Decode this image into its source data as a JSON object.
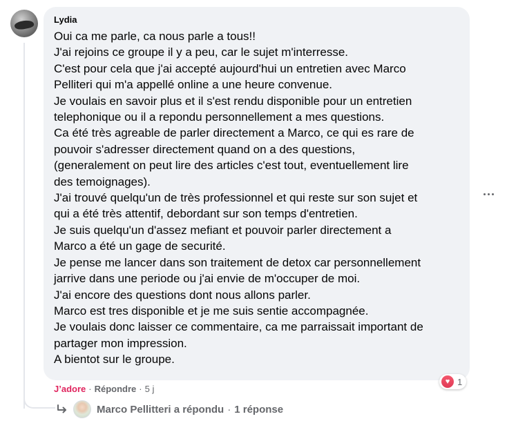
{
  "comment": {
    "author": "Lydia",
    "lines": [
      "Oui ca me parle, ca nous parle a tous!!",
      "J'ai rejoins ce groupe il y a peu, car le sujet m'interresse.",
      "C'est pour cela que j'ai accepté aujourd'hui un entretien avec Marco",
      "Pelliteri qui m'a appellé online a une heure convenue.",
      "Je voulais en savoir plus et il s'est rendu disponible pour un entretien",
      "telephonique ou il a repondu personnellement a mes questions.",
      "Ca été très agreable de parler directement a Marco, ce qui es rare de",
      "pouvoir s'adresser directement quand on a des questions,",
      "(generalement on peut lire des articles c'est tout, eventuellement lire",
      "des temoignages).",
      "J'ai trouvé quelqu'un de très professionnel et qui reste sur son sujet et",
      "qui a été très attentif, debordant sur son temps d'entretien.",
      "Je suis quelqu'un d'assez mefiant et pouvoir parler directement a",
      "Marco a été un gage de securité.",
      "Je pense me lancer dans son traitement de detox car personnellement",
      "jarrive dans une periode ou j'ai envie de m'occuper de moi.",
      "J'ai encore des questions dont nous allons parler.",
      "Marco est tres disponible et je me suis sentie accompagnée.",
      "Je voulais donc laisser ce commentaire, ca me parraissait important de",
      "partager mon impression.",
      "A bientot sur le groupe."
    ]
  },
  "actions": {
    "like_label": "J’adore",
    "separator": "·",
    "reply_label": "Répondre",
    "time": "5 j"
  },
  "reaction": {
    "icon": "heart-icon",
    "count": "1",
    "color": "#e03b56"
  },
  "replies": {
    "text": "Marco Pellitteri a répondu",
    "separator": "·",
    "count_label": "1 réponse"
  },
  "colors": {
    "bubble_bg": "#f0f2f5",
    "text": "#050505",
    "muted": "#65676b",
    "love": "#e0245e"
  }
}
